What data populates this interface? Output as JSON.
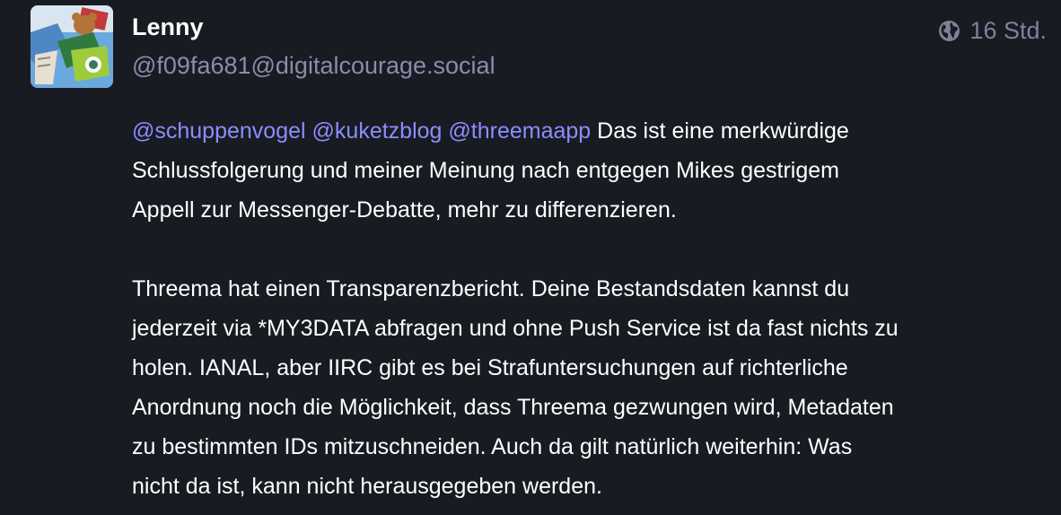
{
  "status": {
    "author": {
      "display_name": "Lenny",
      "handle": "@f09fa681@digitalcourage.social",
      "avatar_icon": "avatar-image"
    },
    "visibility_icon": "globe-icon",
    "timestamp": "16 Std.",
    "paragraphs": [
      {
        "mentions": [
          "@schuppenvogel",
          "@kuketzblog",
          "@threemaapp"
        ],
        "lines": [
          " Das ist eine merkwürdige",
          "Schlussfolgerung und meiner Meinung nach entgegen Mikes gestrigem",
          "Appell zur Messenger-Debatte, mehr zu differenzieren."
        ]
      },
      {
        "lines": [
          "Threema hat einen Transparenzbericht. Deine Bestandsdaten kannst du",
          "jederzeit via *MY3DATA abfragen und ohne Push Service ist da fast nichts zu",
          "holen. IANAL, aber IIRC gibt es bei Strafuntersuchungen auf richterliche",
          "Anordnung noch die Möglichkeit, dass Threema gezwungen wird, Metadaten",
          "zu bestimmten IDs mitzuschneiden. Auch da gilt natürlich weiterhin: Was",
          "nicht da ist, kann nicht herausgegeben werden."
        ]
      }
    ]
  },
  "colors": {
    "background": "#191b22",
    "mention": "#8c8dff",
    "handle": "#8b8cac",
    "meta": "#7f8199"
  }
}
